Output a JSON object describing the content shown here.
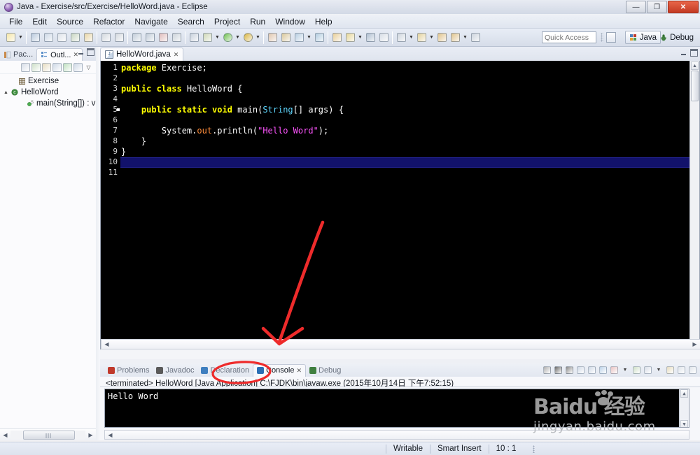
{
  "window": {
    "title": "Java - Exercise/src/Exercise/HelloWord.java - Eclipse",
    "icon_name": "eclipse-icon",
    "minimize_label": "—",
    "maximize_label": "❐",
    "close_label": "✕"
  },
  "menubar": {
    "items": [
      {
        "label": "File"
      },
      {
        "label": "Edit"
      },
      {
        "label": "Source"
      },
      {
        "label": "Refactor"
      },
      {
        "label": "Navigate"
      },
      {
        "label": "Search"
      },
      {
        "label": "Project"
      },
      {
        "label": "Run"
      },
      {
        "label": "Window"
      },
      {
        "label": "Help"
      }
    ]
  },
  "toolbar": {
    "quick_access_placeholder": "Quick Access",
    "perspective_java": "Java",
    "perspective_debug": "Debug",
    "buttons": [
      {
        "name": "new-wizard-icon",
        "color": "#f5e6a8"
      },
      {
        "name": "save-icon",
        "color": "#b9c9dd"
      },
      {
        "name": "save-all-icon",
        "color": "#cdd8e6"
      },
      {
        "name": "print-icon",
        "color": "#dfe4ea"
      },
      {
        "name": "build-all-icon",
        "color": "#c9d6c2"
      },
      {
        "name": "external-tools-icon",
        "color": "#e8d6a8"
      },
      {
        "name": "undo-icon",
        "color": "#d4d9df"
      },
      {
        "name": "redo-icon",
        "color": "#d4d9df"
      },
      {
        "name": "resume-icon",
        "color": "#c2cdd9"
      },
      {
        "name": "suspend-icon",
        "color": "#c2cdd9"
      },
      {
        "name": "terminate-icon",
        "color": "#e0bdbd"
      },
      {
        "name": "disconnect-icon",
        "color": "#ccd3da"
      },
      {
        "name": "step-into-icon",
        "color": "#c9d2dd"
      },
      {
        "name": "debug-icon",
        "color": "#cfd8b8"
      },
      {
        "name": "run-icon",
        "color": "#6fbf4f"
      },
      {
        "name": "run-last-icon",
        "color": "#d8b441"
      },
      {
        "name": "new-java-project-icon",
        "color": "#e0c7b0"
      },
      {
        "name": "new-package-icon",
        "color": "#d9c79c"
      },
      {
        "name": "new-class-icon",
        "color": "#b9cfe2"
      },
      {
        "name": "open-type-icon",
        "color": "#b3cde0"
      },
      {
        "name": "search-icon",
        "color": "#e8cf9a"
      },
      {
        "name": "editor-toggle-icon",
        "color": "#e6d79a"
      },
      {
        "name": "outline-toggle-icon",
        "color": "#aebed0"
      },
      {
        "name": "perspective-icon",
        "color": "#d8dee6"
      },
      {
        "name": "next-annotation-icon",
        "color": "#cfd6de"
      },
      {
        "name": "prev-annotation-icon",
        "color": "#e3d39e"
      },
      {
        "name": "back-icon",
        "color": "#e0c48e"
      },
      {
        "name": "forward-icon",
        "color": "#e0c48e"
      },
      {
        "name": "pin-editor-icon",
        "color": "#cdd4dd"
      }
    ]
  },
  "left_panel": {
    "tabs": [
      {
        "label": "Pac...",
        "icon": "package-explorer-icon",
        "active": false
      },
      {
        "label": "Outl...",
        "icon": "outline-icon",
        "active": true,
        "close": "✕"
      }
    ],
    "minimize_tooltip": "Minimize",
    "maximize_tooltip": "Maximize",
    "toolbar_icons": [
      "collapse-all-icon",
      "sort-icon",
      "hide-fields-icon",
      "hide-static-icon",
      "hide-nonpublic-icon",
      "hide-local-types-icon",
      "view-menu-icon"
    ],
    "tree": [
      {
        "label": "Exercise",
        "icon": "package-icon",
        "indent": 14,
        "twisty": ""
      },
      {
        "label": "HelloWord",
        "icon": "class-icon",
        "indent": 4,
        "twisty": "▲"
      },
      {
        "label": "main(String[]) : v",
        "icon": "method-static-icon",
        "indent": 26,
        "twisty": ""
      }
    ]
  },
  "editor": {
    "tab_label": "HelloWord.java",
    "tab_icon": "java-file-icon",
    "tab_close": "✕",
    "lines": [
      {
        "n": 1,
        "tokens": [
          {
            "t": "package",
            "c": "kw"
          },
          {
            "t": " Exercise;",
            "c": "pln"
          }
        ]
      },
      {
        "n": 2,
        "tokens": []
      },
      {
        "n": 3,
        "tokens": [
          {
            "t": "public class",
            "c": "kw"
          },
          {
            "t": " HelloWord {",
            "c": "pln"
          }
        ]
      },
      {
        "n": 4,
        "tokens": []
      },
      {
        "n": 5,
        "tokens": [
          {
            "t": "    ",
            "c": "pln"
          },
          {
            "t": "public static void",
            "c": "kw"
          },
          {
            "t": " main(",
            "c": "pln"
          },
          {
            "t": "String",
            "c": "typ"
          },
          {
            "t": "[] args) {",
            "c": "pln"
          }
        ],
        "breakpoint": true
      },
      {
        "n": 6,
        "tokens": []
      },
      {
        "n": 7,
        "tokens": [
          {
            "t": "        System.",
            "c": "pln"
          },
          {
            "t": "out",
            "c": "fld"
          },
          {
            "t": ".println(",
            "c": "pln"
          },
          {
            "t": "\"Hello Word\"",
            "c": "str"
          },
          {
            "t": ");",
            "c": "pln"
          }
        ]
      },
      {
        "n": 8,
        "tokens": [
          {
            "t": "    }",
            "c": "pln"
          }
        ]
      },
      {
        "n": 9,
        "tokens": [
          {
            "t": "}",
            "c": "pln"
          }
        ]
      },
      {
        "n": 10,
        "tokens": [],
        "current": true
      },
      {
        "n": 11,
        "tokens": []
      }
    ]
  },
  "console_panel": {
    "tabs": [
      {
        "label": "Problems",
        "icon": "problems-icon",
        "active": false
      },
      {
        "label": "Javadoc",
        "icon": "javadoc-icon",
        "active": false
      },
      {
        "label": "Declaration",
        "icon": "declaration-icon",
        "active": false
      },
      {
        "label": "Console",
        "icon": "console-icon",
        "active": true,
        "close": "✕"
      },
      {
        "label": "Debug",
        "icon": "debug-view-icon",
        "active": false
      }
    ],
    "terminated_line": "<terminated> HelloWord [Java Application] C:\\FJDK\\bin\\javaw.exe (2015年10月14日 下午7:52:15)",
    "output": "Hello Word",
    "tool_icons": [
      "terminate-icon",
      "remove-launch-icon",
      "remove-all-terminated-icon",
      "clear-console-icon",
      "scroll-lock-icon",
      "show-console-on-output-icon",
      "show-console-on-error-icon",
      "pin-console-icon",
      "display-selected-console-icon",
      "open-console-icon",
      "minimize-icon",
      "maximize-icon"
    ]
  },
  "statusbar": {
    "writable": "Writable",
    "insert_mode": "Smart Insert",
    "position": "10 : 1"
  },
  "watermark": {
    "main": "Baidu 经验",
    "brand_left": "Bai",
    "brand_right": "du",
    "brand_cn": "经验",
    "sub": "jingyan.baidu.com"
  },
  "annotations": {
    "arrow_color": "#ee2b2b",
    "circle_color": "#ee2b2b",
    "arrow_name": "red-arrow-annotation",
    "circle_name": "red-circle-annotation"
  },
  "colors": {
    "keyword": "#ffff00",
    "type": "#5fd7ff",
    "string": "#ff55ff",
    "field": "#ff8c3a",
    "editor_bg": "#000000",
    "current_line": "#12126b"
  }
}
